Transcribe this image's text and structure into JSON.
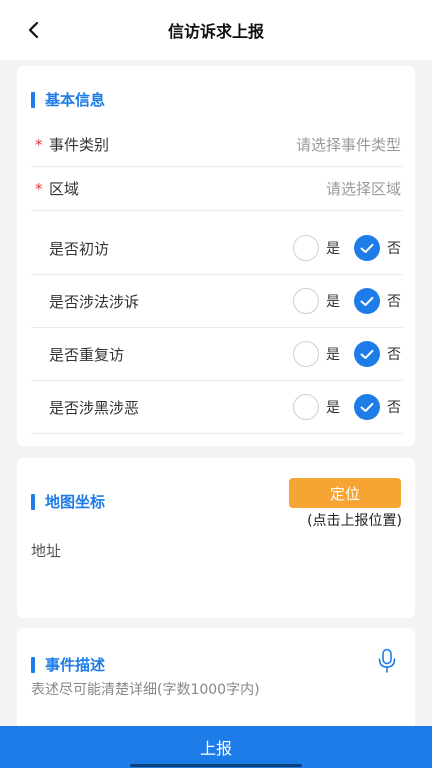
{
  "header": {
    "title": "信访诉求上报"
  },
  "basic_info": {
    "section_title": "基本信息",
    "fields": [
      {
        "label": "事件类别",
        "placeholder": "请选择事件类型",
        "required": true
      },
      {
        "label": "区域",
        "placeholder": "请选择区域",
        "required": true
      }
    ],
    "required_mark": "*",
    "yes_label": "是",
    "no_label": "否",
    "questions": [
      {
        "label": "是否初访",
        "selected": "否"
      },
      {
        "label": "是否涉法涉诉",
        "selected": "否"
      },
      {
        "label": "是否重复访",
        "selected": "否"
      },
      {
        "label": "是否涉黑涉恶",
        "selected": "否"
      }
    ]
  },
  "map": {
    "section_title": "地图坐标",
    "locate_button": "定位",
    "locate_hint": "(点击上报位置)",
    "address_label": "地址"
  },
  "description": {
    "section_title": "事件描述",
    "placeholder": "表述尽可能清楚详细(字数1000字内)",
    "mic_icon": "microphone-icon"
  },
  "footer": {
    "submit_label": "上报"
  },
  "colors": {
    "primary": "#1e7ce8",
    "accent": "#f6a535",
    "required": "#e53935"
  }
}
